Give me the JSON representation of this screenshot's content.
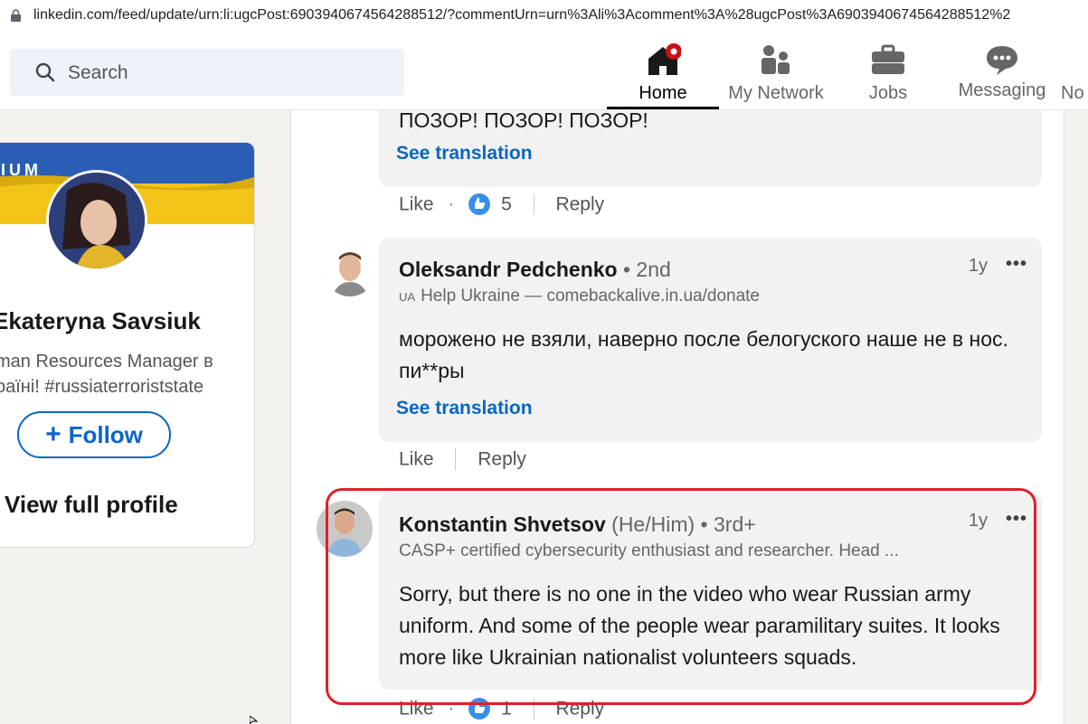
{
  "browser": {
    "url": "linkedin.com/feed/update/urn:li:ugcPost:6903940674564288512/?commentUrn=urn%3Ali%3Acomment%3A%28ugcPost%3A6903940674564288512%2"
  },
  "topnav": {
    "search_placeholder": "Search",
    "items": [
      {
        "label": "Home",
        "icon": "home-icon",
        "active": true
      },
      {
        "label": "My Network",
        "icon": "network-icon"
      },
      {
        "label": "Jobs",
        "icon": "briefcase-icon"
      },
      {
        "label": "Messaging",
        "icon": "messaging-icon"
      },
      {
        "label": "No"
      }
    ]
  },
  "profile": {
    "banner_text": "IUM",
    "name": "Ekateryna Savsiuk",
    "headline_line1": "man Resources Manager в",
    "headline_line2": "раїні! #russiaterroriststate",
    "follow_label": "Follow",
    "view_profile_label": "View full profile"
  },
  "comments": [
    {
      "text_partial": "ПОЗОР! ПОЗОР! ПОЗОР!",
      "see_translation": "See translation",
      "actions": {
        "like": "Like",
        "reaction_count": "5",
        "reply": "Reply"
      }
    },
    {
      "name": "Oleksandr Pedchenko",
      "degree": "• 2nd",
      "headline_flag": "UA",
      "headline": "Help Ukraine — comebackalive.in.ua/donate",
      "time": "1y",
      "text": "морожено не взяли, наверно после белогуского наше не в нос. пи**ры",
      "see_translation": "See translation",
      "actions": {
        "like": "Like",
        "reply": "Reply"
      }
    },
    {
      "name": "Konstantin Shvetsov",
      "pronouns": "(He/Him)",
      "degree": "• 3rd+",
      "headline": "CASP+ certified cybersecurity enthusiast and researcher. Head ...",
      "time": "1y",
      "text": "Sorry, but there is no one in the video who wear Russian army uniform. And some of the people wear paramilitary suites. It looks more like Ukrainian nationalist volunteers squads.",
      "actions": {
        "like": "Like",
        "reaction_count": "1",
        "reply": "Reply"
      },
      "highlighted": true
    }
  ],
  "colors": {
    "accent": "#0a66c2",
    "highlight": "#e0202b",
    "notification": "#cc1016"
  }
}
